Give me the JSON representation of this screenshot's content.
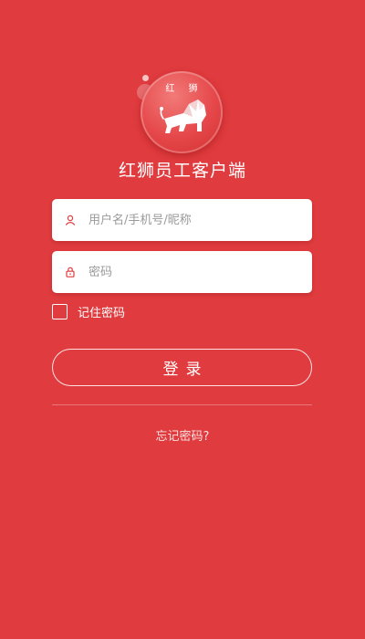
{
  "logo": {
    "text": "红 狮",
    "icon": "lion-icon"
  },
  "app": {
    "title": "红狮员工客户端"
  },
  "form": {
    "username": {
      "placeholder": "用户名/手机号/昵称",
      "value": "",
      "icon": "user-icon"
    },
    "password": {
      "placeholder": "密码",
      "value": "",
      "icon": "lock-icon"
    },
    "remember_label": "记住密码",
    "remember_checked": false,
    "login_label": "登录",
    "forgot_label": "忘记密码?"
  },
  "colors": {
    "background": "#e03b3e",
    "field_background": "#ffffff",
    "icon_accent": "#e03b3e",
    "text_light": "#ffffff"
  }
}
